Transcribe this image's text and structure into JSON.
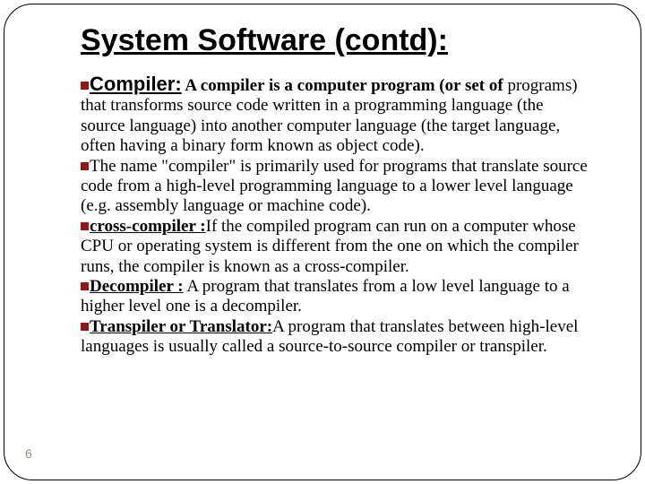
{
  "title": "System Software (contd):",
  "sections": {
    "compiler": {
      "term": "Compiler:",
      "lead": " A compiler is a computer program (or set of",
      "rest": "programs) that transforms source code written in a programming language (the source language) into another computer language (the target language, often having a binary form known as object code)."
    },
    "name": {
      "text": "The name \"compiler\" is primarily used for programs that translate source code from a high-level programming language to a lower level language (e.g. assembly language or machine code)."
    },
    "cross": {
      "term": "cross-compiler :",
      "text": "If the compiled program can run on a computer whose CPU or operating system is different from the one on which the compiler runs, the compiler is known as a cross-compiler."
    },
    "decompiler": {
      "term": "Decompiler :",
      "text": " A program that translates from a low level language to a higher level one is a decompiler."
    },
    "transpiler": {
      "term": "Transpiler  or Translator:",
      "text": "A program that translates between high-level languages is usually called a source-to-source compiler or transpiler."
    }
  },
  "page_number": "6"
}
